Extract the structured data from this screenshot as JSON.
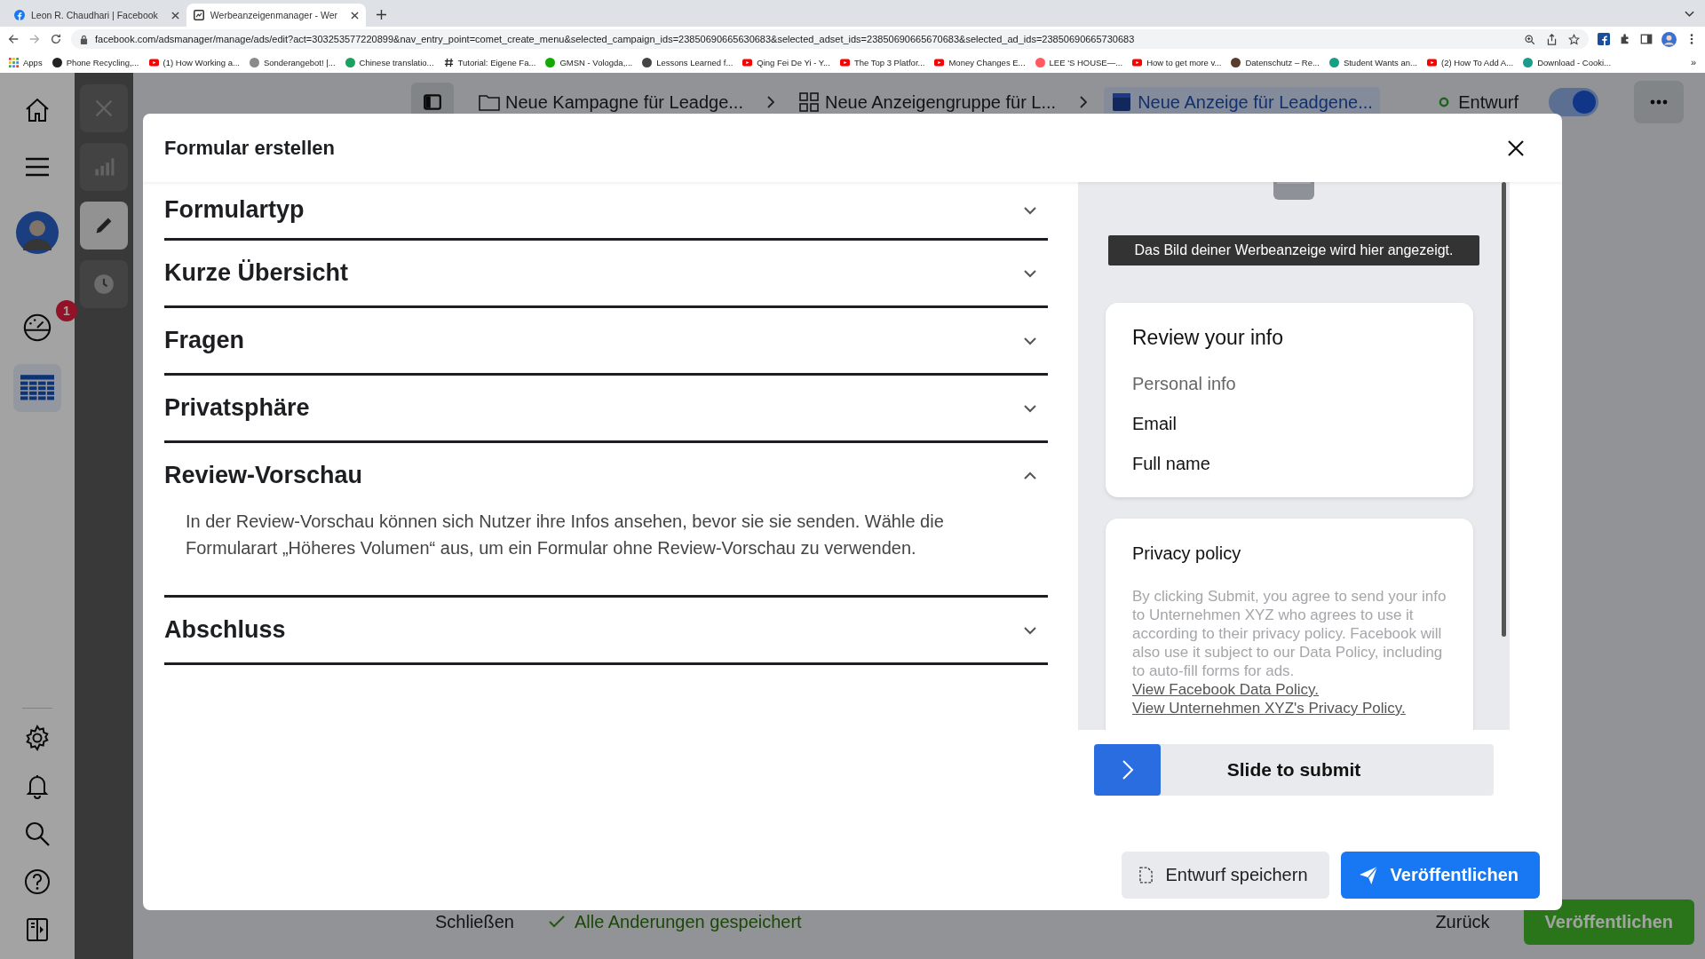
{
  "browser": {
    "tabs": [
      {
        "title": "Leon R. Chaudhari | Facebook",
        "kind": "facebook",
        "selected": false
      },
      {
        "title": "Werbeanzeigenmanager - Wer",
        "kind": "page",
        "selected": true
      }
    ],
    "url": "facebook.com/adsmanager/manage/ads/edit?act=303253577220899&nav_entry_point=comet_create_menu&selected_campaign_ids=23850690665630683&selected_adset_ids=23850690665670683&selected_ad_ids=23850690665730683",
    "bookmarks": [
      {
        "label": "Apps",
        "kind": "apps"
      },
      {
        "label": "Phone Recycling,...",
        "kind": "dot",
        "color": "#222222"
      },
      {
        "label": "(1) How Working a...",
        "kind": "youtube"
      },
      {
        "label": "Sonderangebot! |...",
        "kind": "dot",
        "color": "#8a8a8a"
      },
      {
        "label": "Chinese translatio...",
        "kind": "dot",
        "color": "#1aa260"
      },
      {
        "label": "Tutorial: Eigene Fa...",
        "kind": "hash"
      },
      {
        "label": "GMSN - Vologda,...",
        "kind": "dot",
        "color": "#14a800"
      },
      {
        "label": "Lessons Learned f...",
        "kind": "dot",
        "color": "#444444"
      },
      {
        "label": "Qing Fei De Yi - Y...",
        "kind": "youtube"
      },
      {
        "label": "The Top 3 Platfor...",
        "kind": "youtube"
      },
      {
        "label": "Money Changes E...",
        "kind": "youtube"
      },
      {
        "label": "LEE 'S HOUSE—...",
        "kind": "dot",
        "color": "#ff5a5f"
      },
      {
        "label": "How to get more v...",
        "kind": "youtube"
      },
      {
        "label": "Datenschutz – Re...",
        "kind": "dot",
        "color": "#5a3a2a"
      },
      {
        "label": "Student Wants an...",
        "kind": "dot",
        "color": "#16a085"
      },
      {
        "label": "(2) How To Add A...",
        "kind": "youtube"
      },
      {
        "label": "Download - Cooki...",
        "kind": "dot",
        "color": "#1a9c8c"
      }
    ],
    "bookmarks_more": "»"
  },
  "sidebar": {
    "items": [
      {
        "kind": "home",
        "selected": false
      },
      {
        "kind": "menu",
        "selected": false
      },
      {
        "kind": "avatar",
        "selected": false
      },
      {
        "kind": "gauge",
        "selected": false,
        "badge": "1"
      },
      {
        "kind": "table",
        "selected": true
      }
    ],
    "bottom_items": [
      {
        "kind": "settings"
      },
      {
        "kind": "bell"
      },
      {
        "kind": "search"
      },
      {
        "kind": "help"
      },
      {
        "kind": "panel"
      }
    ]
  },
  "tool_panel": [
    {
      "kind": "close",
      "selected": false
    },
    {
      "kind": "chart",
      "selected": false
    },
    {
      "kind": "edit",
      "selected": true
    },
    {
      "kind": "history",
      "selected": false
    }
  ],
  "top_bar": {
    "breadcrumbs": [
      {
        "label": "Neue Kampagne für Leadge...",
        "kind": "folder",
        "selected": false
      },
      {
        "label": "Neue Anzeigengruppe für L...",
        "kind": "grid",
        "selected": false
      },
      {
        "label": "Neue Anzeige für Leadgene...",
        "kind": "ad",
        "selected": true
      }
    ],
    "status": "Entwurf",
    "toggle_on": true
  },
  "bottom_bar": {
    "close_button": "Schließen",
    "saved_status": "Alle Anderungen gespeichert",
    "back_button": "Zurück",
    "publish_button": "Veröffentlichen"
  },
  "modal": {
    "title": "Formular erstellen",
    "sections": [
      {
        "title": "Formulartyp",
        "expanded": false
      },
      {
        "title": "Kurze Übersicht",
        "expanded": false
      },
      {
        "title": "Fragen",
        "expanded": false
      },
      {
        "title": "Privatsphäre",
        "expanded": false
      },
      {
        "title": "Review-Vorschau",
        "expanded": true,
        "body": "In der Review-Vorschau können sich Nutzer ihre Infos ansehen, bevor sie sie senden. Wähle die Formularart „Höheres Volumen“ aus, um ein Formular ohne Review-Vorschau zu verwenden."
      },
      {
        "title": "Abschluss",
        "expanded": false
      }
    ],
    "preview": {
      "image_caption": "Das Bild deiner Werbeanzeige wird hier angezeigt.",
      "review_card": {
        "title": "Review your info",
        "subtitle": "Personal info",
        "fields": [
          "Email",
          "Full name"
        ]
      },
      "privacy_card": {
        "title": "Privacy policy",
        "text": "By clicking Submit, you agree to send your info to Unternehmen XYZ who agrees to use it according to their privacy policy. Facebook will also use it subject to our Data Policy, including to auto-fill forms for ads.",
        "links": [
          "View Facebook Data Policy.",
          "View Unternehmen XYZ's Privacy Policy."
        ]
      },
      "slider": {
        "label": "Slide to submit",
        "level": 0
      }
    },
    "buttons": [
      {
        "label": "Entwurf speichern",
        "kind": "secondary"
      },
      {
        "label": "Veröffentlichen",
        "kind": "primary"
      }
    ]
  }
}
